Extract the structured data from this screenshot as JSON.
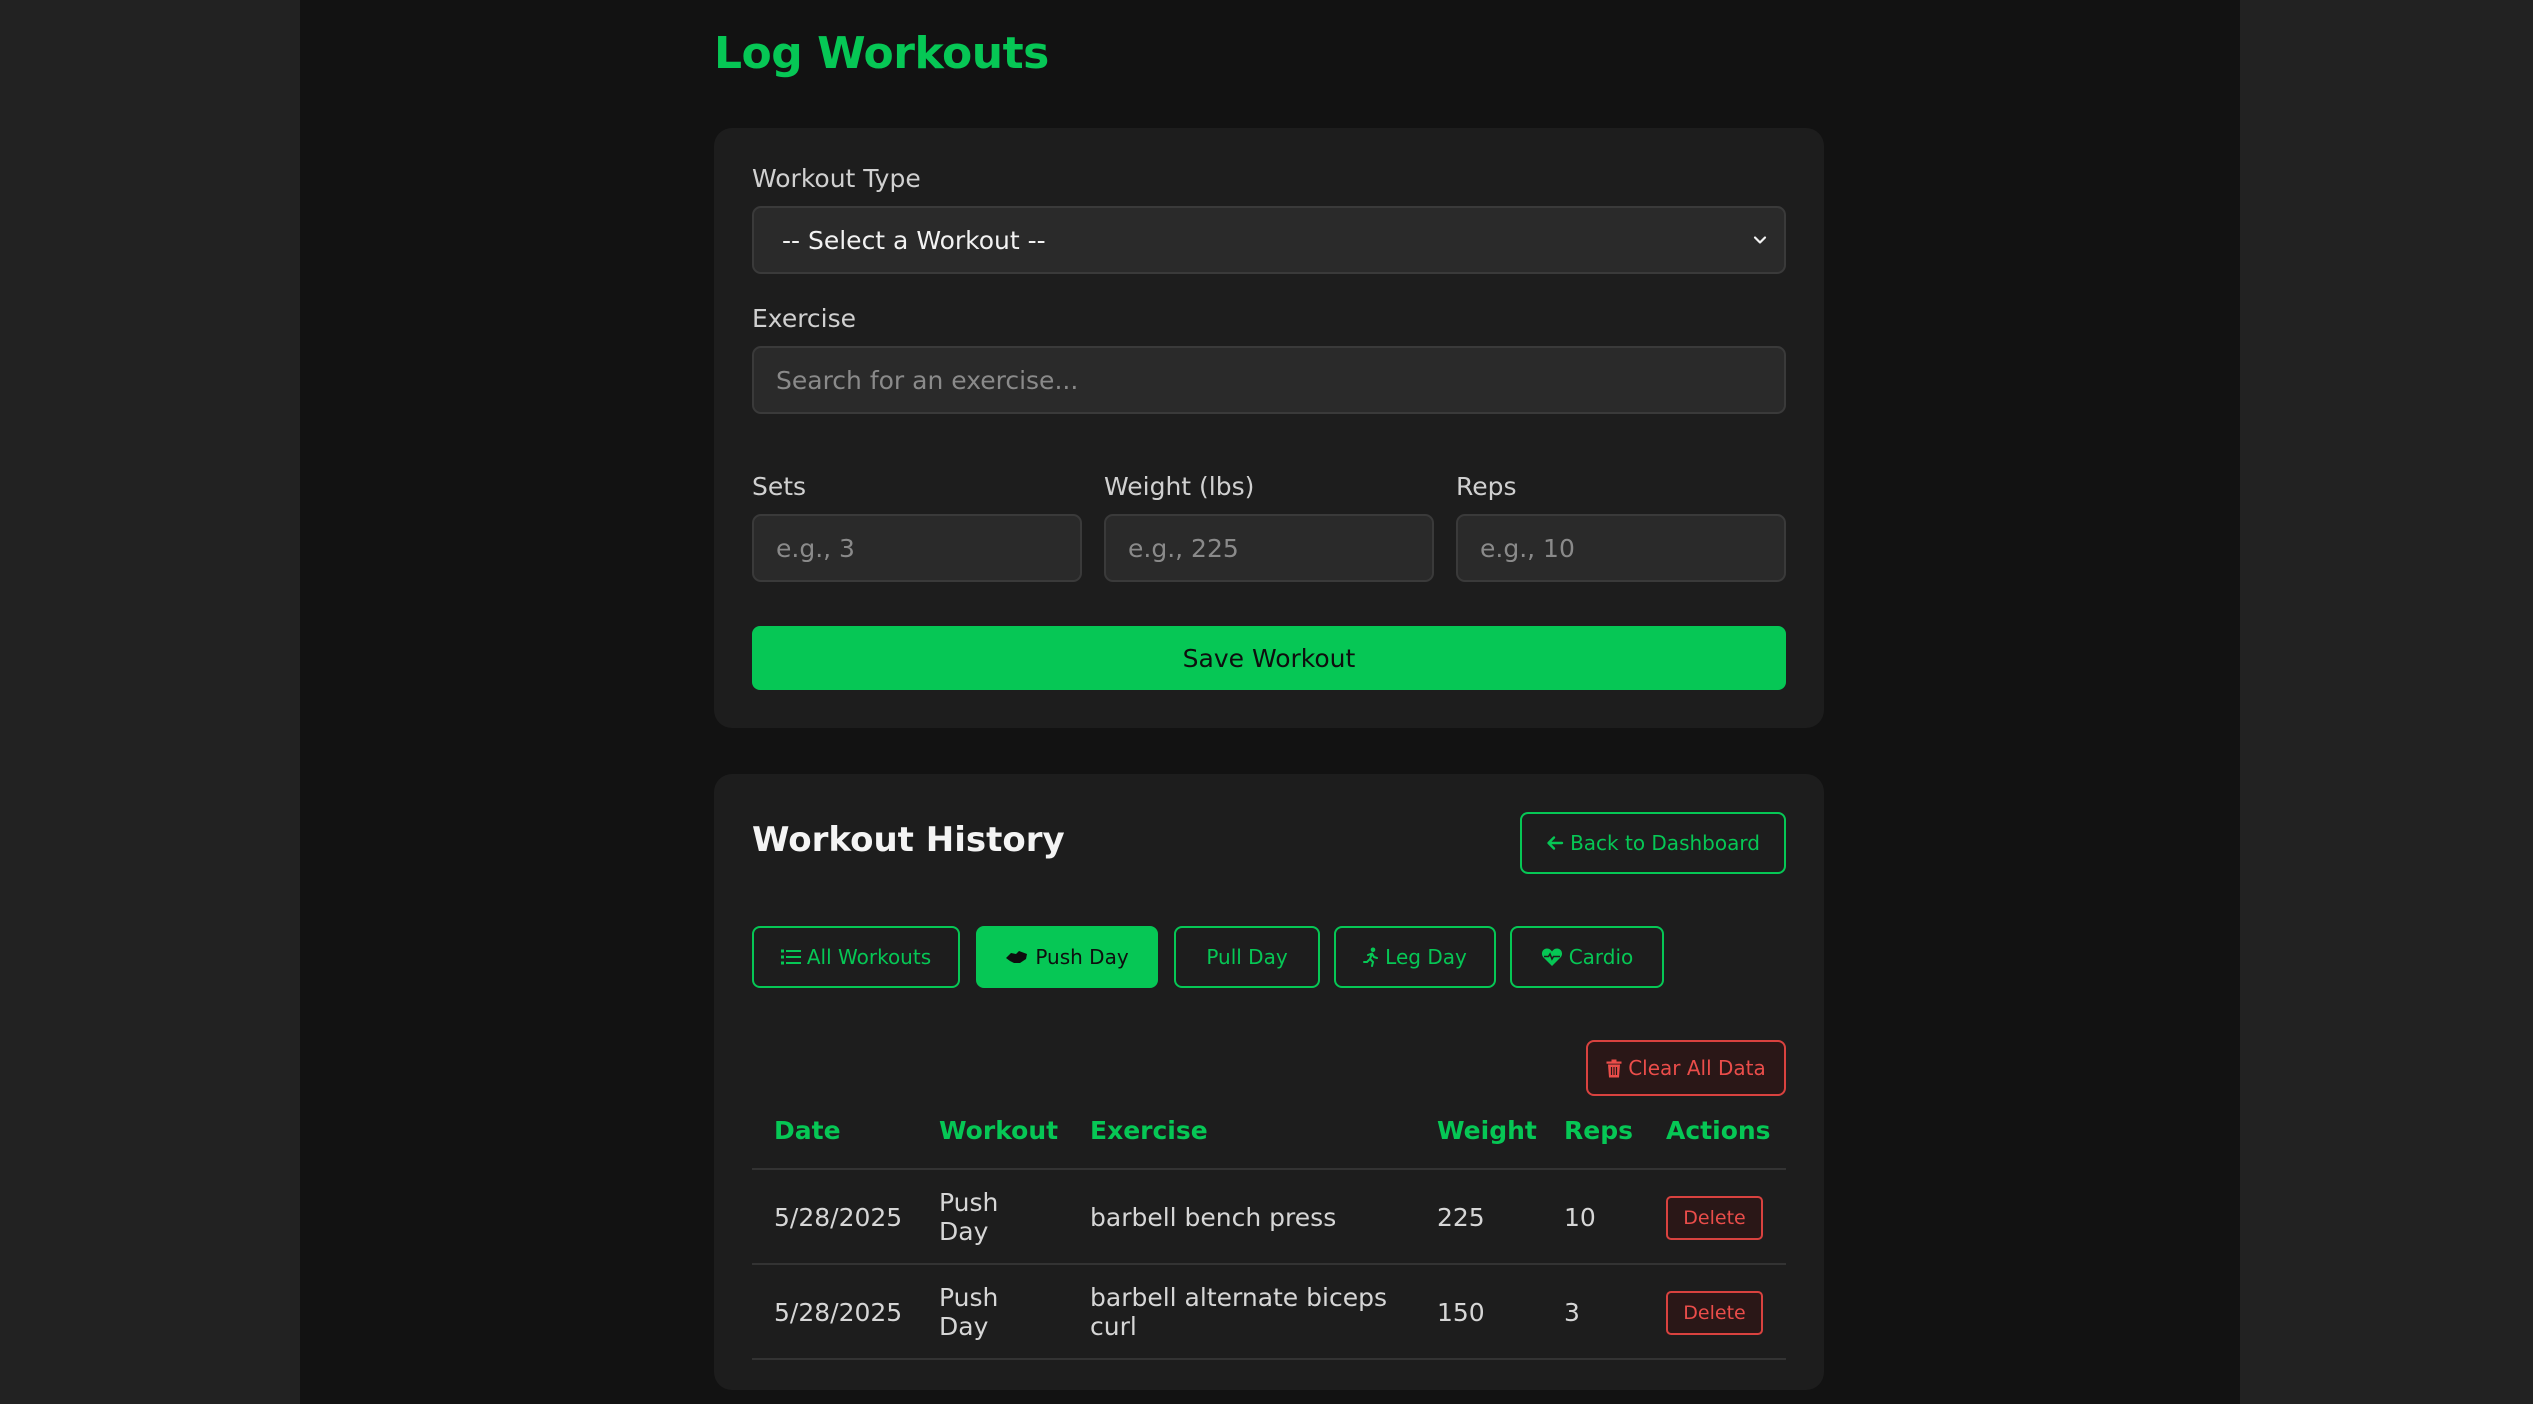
{
  "page": {
    "title": "Log Workouts"
  },
  "form": {
    "workout_type_label": "Workout Type",
    "workout_type_selected": "-- Select a Workout --",
    "exercise_label": "Exercise",
    "exercise_placeholder": "Search for an exercise...",
    "sets_label": "Sets",
    "sets_placeholder": "e.g., 3",
    "weight_label": "Weight (lbs)",
    "weight_placeholder": "e.g., 225",
    "reps_label": "Reps",
    "reps_placeholder": "e.g., 10",
    "save_label": "Save Workout"
  },
  "history": {
    "title": "Workout History",
    "back_label": "Back to Dashboard",
    "filters": [
      {
        "label": "All Workouts",
        "icon": "list-icon",
        "active": false
      },
      {
        "label": "Push Day",
        "icon": "hands-icon",
        "active": true
      },
      {
        "label": "Pull Day",
        "icon": "",
        "active": false
      },
      {
        "label": "Leg Day",
        "icon": "running-icon",
        "active": false
      },
      {
        "label": "Cardio",
        "icon": "heart-pulse-icon",
        "active": false
      }
    ],
    "clear_label": "Clear All Data",
    "columns": [
      "Date",
      "Workout",
      "Exercise",
      "Weight",
      "Reps",
      "Actions"
    ],
    "rows": [
      {
        "date": "5/28/2025",
        "workout_line1": "Push",
        "workout_line2": "Day",
        "exercise_line1": "barbell bench press",
        "exercise_line2": "",
        "weight": "225",
        "reps": "10",
        "action": "Delete"
      },
      {
        "date": "5/28/2025",
        "workout_line1": "Push",
        "workout_line2": "Day",
        "exercise_line1": "barbell alternate biceps",
        "exercise_line2": "curl",
        "weight": "150",
        "reps": "3",
        "action": "Delete"
      }
    ]
  },
  "colors": {
    "accent": "#06c755",
    "danger": "#ea4d4a",
    "background": "#121212",
    "card": "#1d1d1d",
    "outer": "#222222"
  }
}
